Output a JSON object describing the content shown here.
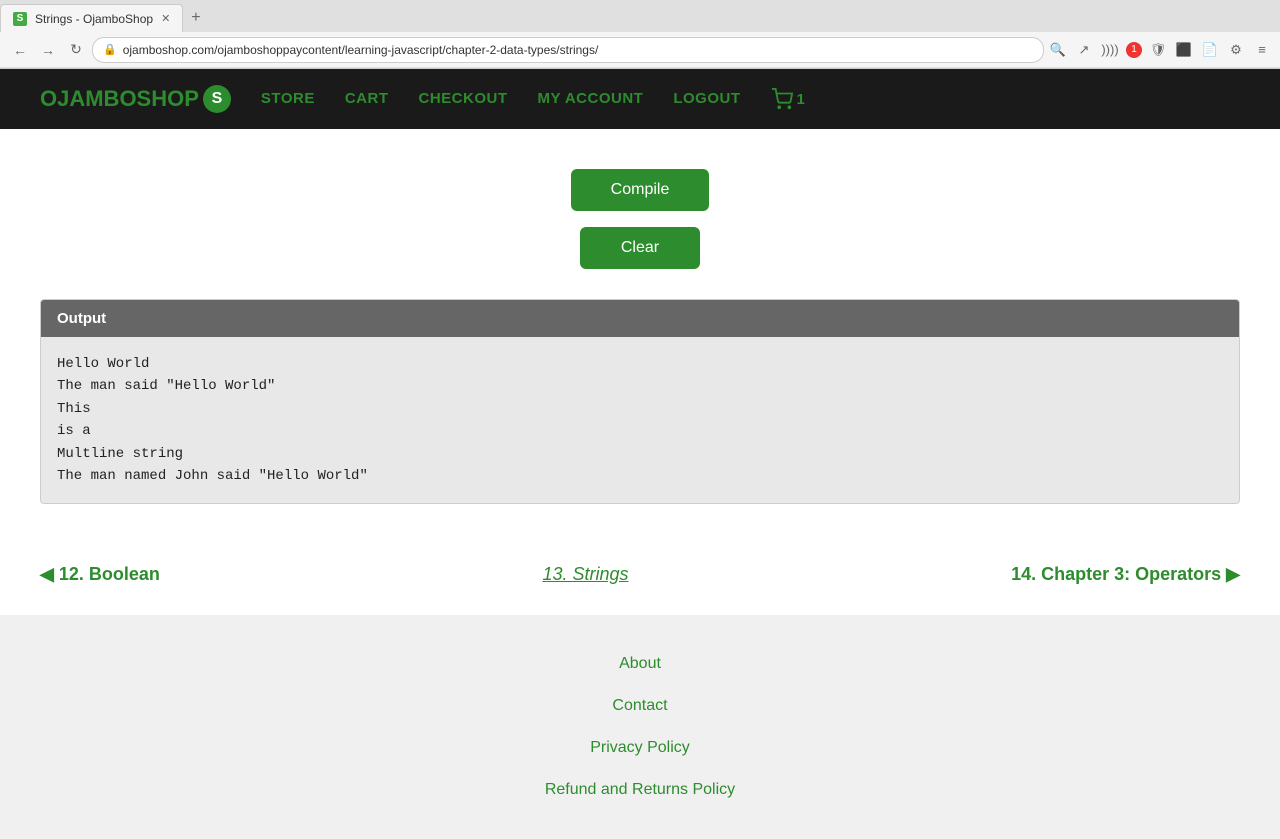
{
  "browser": {
    "tab_title": "Strings - OjamboShop",
    "url": "ojamboshop.com/ojamboshoppaycontent/learning-javascript/chapter-2-data-types/strings/",
    "favicon_letter": "S"
  },
  "nav": {
    "logo_text": "OJAMBOSHOP",
    "logo_letter": "S",
    "links": [
      {
        "label": "STORE",
        "href": "#"
      },
      {
        "label": "CART",
        "href": "#"
      },
      {
        "label": "CHECKOUT",
        "href": "#"
      },
      {
        "label": "MY ACCOUNT",
        "href": "#"
      },
      {
        "label": "LOGOUT",
        "href": "#"
      }
    ],
    "cart_count": "1"
  },
  "buttons": {
    "compile_label": "Compile",
    "clear_label": "Clear"
  },
  "output": {
    "header": "Output",
    "lines": [
      "Hello World",
      "The man said \"Hello World\"",
      "This",
      "is a",
      "Multline string",
      "The man named John said \"Hello World\""
    ]
  },
  "lesson_nav": {
    "prev_label": "12. Boolean",
    "current_label": "13. Strings",
    "next_label": "14. Chapter 3: Operators"
  },
  "footer": {
    "links": [
      {
        "label": "About",
        "href": "#"
      },
      {
        "label": "Contact",
        "href": "#"
      },
      {
        "label": "Privacy Policy",
        "href": "#"
      },
      {
        "label": "Refund and Returns Policy",
        "href": "#"
      }
    ]
  }
}
